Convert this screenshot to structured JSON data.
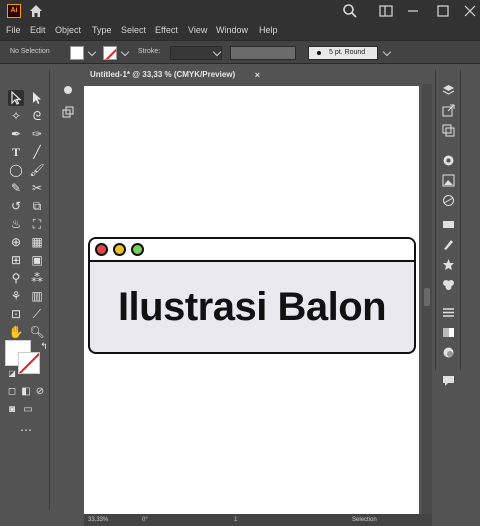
{
  "app": {
    "logo_text": "Ai"
  },
  "menu": [
    "File",
    "Edit",
    "Object",
    "Type",
    "Select",
    "Effect",
    "View",
    "Window",
    "Help"
  ],
  "control": {
    "selection_label": "No Selection",
    "stroke_label": "Stroke:",
    "brush_label": "5 pt. Round"
  },
  "document": {
    "tab_title": "Untitled-1* @ 33,33 % (CMYK/Preview)",
    "close_symbol": "×"
  },
  "artwork": {
    "title": "Ilustrasi Balon",
    "dots": [
      {
        "color": "#e04848"
      },
      {
        "color": "#f2c028"
      },
      {
        "color": "#6fd05a"
      }
    ]
  },
  "status": {
    "zoom": "33,33%",
    "rotation": "0°",
    "artboard": "1",
    "mode": "Selection"
  },
  "icons": {
    "left_tools": [
      "selection-tool-icon",
      "direct-selection-tool-icon",
      "magic-wand-icon",
      "lasso-icon",
      "pen-icon",
      "curvature-icon",
      "type-icon",
      "line-icon",
      "ellipse-icon",
      "paintbrush-icon",
      "pencil-icon",
      "scissors-icon",
      "rotate-icon",
      "scale-icon",
      "warp-icon",
      "free-transform-icon",
      "shape-builder-icon",
      "perspective-icon",
      "mesh-icon",
      "gradient-icon",
      "eyedropper-icon",
      "blend-icon",
      "symbol-sprayer-icon",
      "graph-icon",
      "artboard-icon",
      "slice-icon",
      "hand-icon",
      "zoom-icon"
    ]
  }
}
